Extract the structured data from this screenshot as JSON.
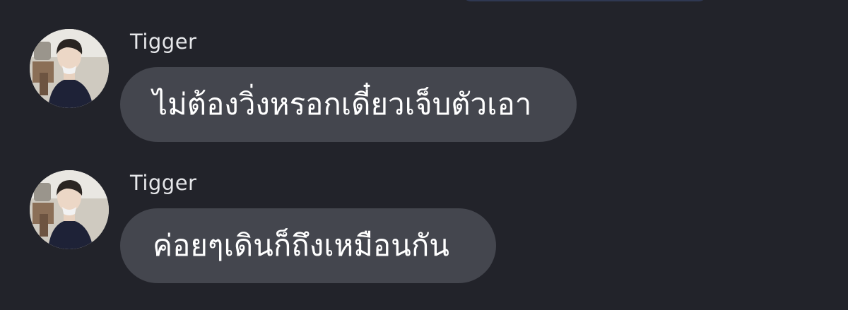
{
  "chat": {
    "messages": [
      {
        "sender": "Tigger",
        "avatar": "user-avatar-photo",
        "text": "ไม่ต้องวิ่งหรอกเดี๋ยวเจ็บตัวเอา"
      },
      {
        "sender": "Tigger",
        "avatar": "user-avatar-photo",
        "text": "ค่อยๆเดินก็ถึงเหมือนกัน"
      }
    ]
  },
  "colors": {
    "background": "#22232a",
    "bubble": "#44464e",
    "text": "#ffffff",
    "sender_name": "#e6e7ea"
  }
}
